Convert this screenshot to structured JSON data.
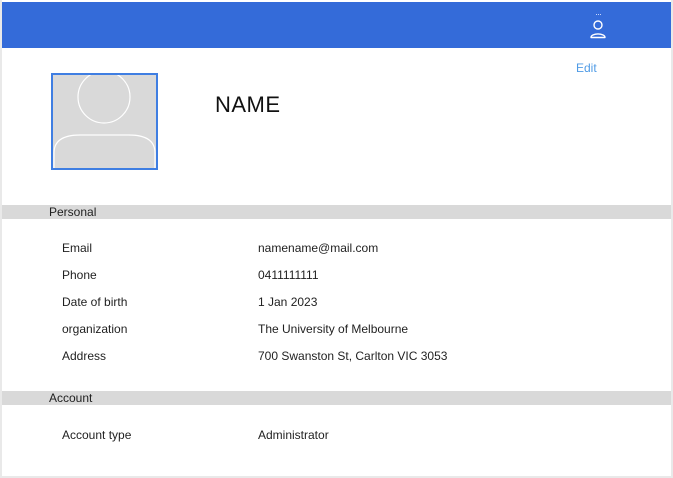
{
  "header": {
    "user_menu_dots": "···",
    "user_icon": "person-icon",
    "accent_color": "#346bd9"
  },
  "profile": {
    "edit_label": "Edit",
    "name": "NAME",
    "avatar_icon": "avatar-placeholder-icon"
  },
  "personal": {
    "title": "Personal",
    "fields": [
      {
        "label": "Email",
        "value": "namename@mail.com"
      },
      {
        "label": "Phone",
        "value": "0411111111"
      },
      {
        "label": "Date of birth",
        "value": "1 Jan 2023"
      },
      {
        "label": "organization",
        "value": "The University of Melbourne"
      },
      {
        "label": "Address",
        "value": "700 Swanston St, Carlton VIC 3053"
      }
    ]
  },
  "account": {
    "title": "Account",
    "fields": [
      {
        "label": "Account type",
        "value": "Administrator"
      }
    ]
  }
}
